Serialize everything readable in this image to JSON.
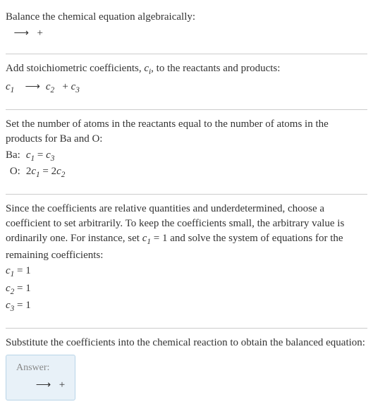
{
  "section1": {
    "title": "Balance the chemical equation algebraically:",
    "arrow": "⟶",
    "plus": "+"
  },
  "section2": {
    "line1_a": "Add stoichiometric coefficients, ",
    "line1_ci": "c",
    "line1_ci_sub": "i",
    "line1_b": ", to the reactants and products:",
    "c1": "c",
    "c1sub": "1",
    "arrow": "⟶",
    "c2": "c",
    "c2sub": "2",
    "plus": "+",
    "c3": "c",
    "c3sub": "3"
  },
  "section3": {
    "text": "Set the number of atoms in the reactants equal to the number of atoms in the products for Ba and O:",
    "ba_label": "Ba:",
    "o_label": "O:",
    "ba_lhs_c": "c",
    "ba_lhs_sub": "1",
    "ba_eq": "=",
    "ba_rhs_c": "c",
    "ba_rhs_sub": "3",
    "o_lhs_coef": "2",
    "o_lhs_c": "c",
    "o_lhs_sub": "1",
    "o_eq": "=",
    "o_rhs_coef": "2",
    "o_rhs_c": "c",
    "o_rhs_sub": "2"
  },
  "section4": {
    "text_a": "Since the coefficients are relative quantities and underdetermined, choose a coefficient to set arbitrarily. To keep the coefficients small, the arbitrary value is ordinarily one. For instance, set ",
    "text_c": "c",
    "text_sub": "1",
    "text_b": " = 1 and solve the system of equations for the remaining coefficients:",
    "r1_c": "c",
    "r1_sub": "1",
    "r1_eq": " = 1",
    "r2_c": "c",
    "r2_sub": "2",
    "r2_eq": " = 1",
    "r3_c": "c",
    "r3_sub": "3",
    "r3_eq": " = 1"
  },
  "section5": {
    "text": "Substitute the coefficients into the chemical reaction to obtain the balanced equation:",
    "answer_label": "Answer:",
    "arrow": "⟶",
    "plus": "+"
  }
}
